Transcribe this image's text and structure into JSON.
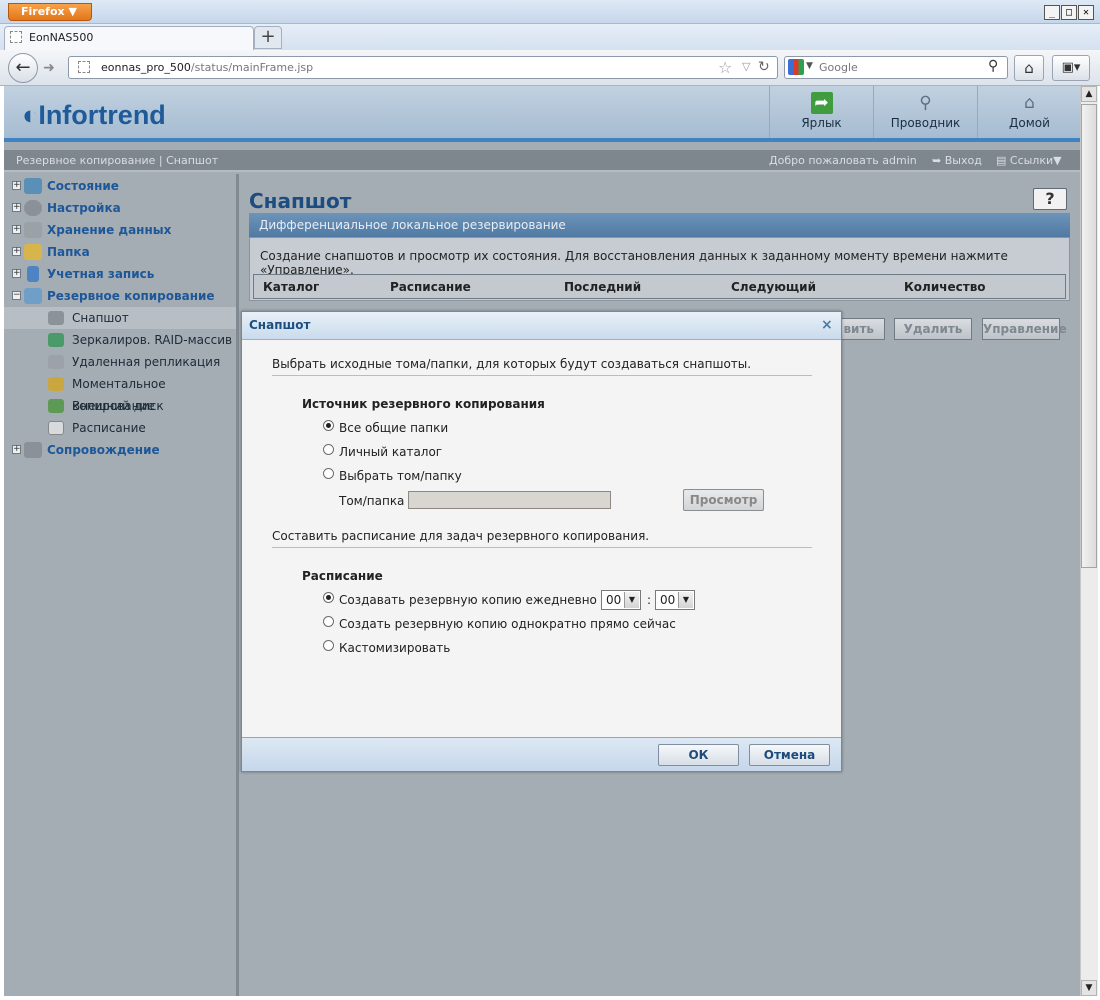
{
  "browser": {
    "app_button": "Firefox ▼",
    "tab_title": "EonNAS500",
    "new_tab": "+",
    "url_host": "eonnas_pro_500",
    "url_path": "/status/mainFrame.jsp",
    "search_placeholder": "Google",
    "win_min": "_",
    "win_max": "□",
    "win_close": "✕"
  },
  "header": {
    "logo": "Infortrend",
    "buttons": [
      "Ярлык",
      "Проводник",
      "Домой"
    ],
    "colors": {
      "accent": "#3f83c3",
      "link": "#1e5798"
    }
  },
  "topbar": {
    "breadcrumb": "Резервное копирование | Снапшот",
    "welcome": "Добро пожаловать admin",
    "logout": "Выход",
    "links": "Ссылки▼"
  },
  "sidebar": {
    "items": [
      {
        "label": "Состояние",
        "expand": "+",
        "icon": "chart-icon"
      },
      {
        "label": "Настройка",
        "expand": "+",
        "icon": "gear-icon"
      },
      {
        "label": "Хранение данных",
        "expand": "+",
        "icon": "disk-icon"
      },
      {
        "label": "Папка",
        "expand": "+",
        "icon": "folder-icon"
      },
      {
        "label": "Учетная запись",
        "expand": "+",
        "icon": "user-icon"
      },
      {
        "label": "Резервное копирование",
        "expand": "−",
        "icon": "backup-icon"
      },
      {
        "label": "Сопровождение",
        "expand": "+",
        "icon": "tools-icon"
      }
    ],
    "sub_items": [
      {
        "label": "Снапшот",
        "icon": "camera-icon"
      },
      {
        "label": "Зеркалиров. RAID-массив",
        "icon": "mirror-icon"
      },
      {
        "label": "Удаленная репликация",
        "icon": "replication-icon"
      },
      {
        "label": "Моментальное копирование",
        "icon": "instant-copy-icon"
      },
      {
        "label": "Внешний диск",
        "icon": "external-disk-icon"
      },
      {
        "label": "Расписание",
        "icon": "calendar-icon"
      }
    ]
  },
  "main": {
    "title": "Снапшот",
    "help": "?",
    "panel_title": "Дифференциальное локальное резервирование",
    "description": "Создание снапшотов и просмотр их состояния. Для восстановления данных к заданному моменту времени нажмите «Управление».",
    "columns": [
      "Каталог",
      "Расписание",
      "Последний",
      "Следующий",
      "Количество"
    ],
    "toolbar": {
      "add_partial": "вить",
      "delete": "Удалить",
      "manage": "Управление"
    }
  },
  "dialog": {
    "title": "Снапшот",
    "close": "×",
    "intro": "Выбрать исходные тома/папки, для которых будут создаваться снапшоты.",
    "source_heading": "Источник резервного копирования",
    "source_options": [
      "Все общие папки",
      "Личный каталог",
      "Выбрать том/папку"
    ],
    "source_selected": 0,
    "volume_label": "Том/папка",
    "volume_value": "",
    "browse": "Просмотр",
    "schedule_intro": "Составить расписание для задач резервного копирования.",
    "schedule_heading": "Расписание",
    "schedule_options": [
      "Создавать резервную копию ежедневно в",
      "Создать резервную копию однократно прямо сейчас",
      "Кастомизировать"
    ],
    "schedule_selected": 0,
    "hour": "00",
    "minute": "00",
    "time_sep": ":",
    "ok": "ОК",
    "cancel": "Отмена"
  }
}
